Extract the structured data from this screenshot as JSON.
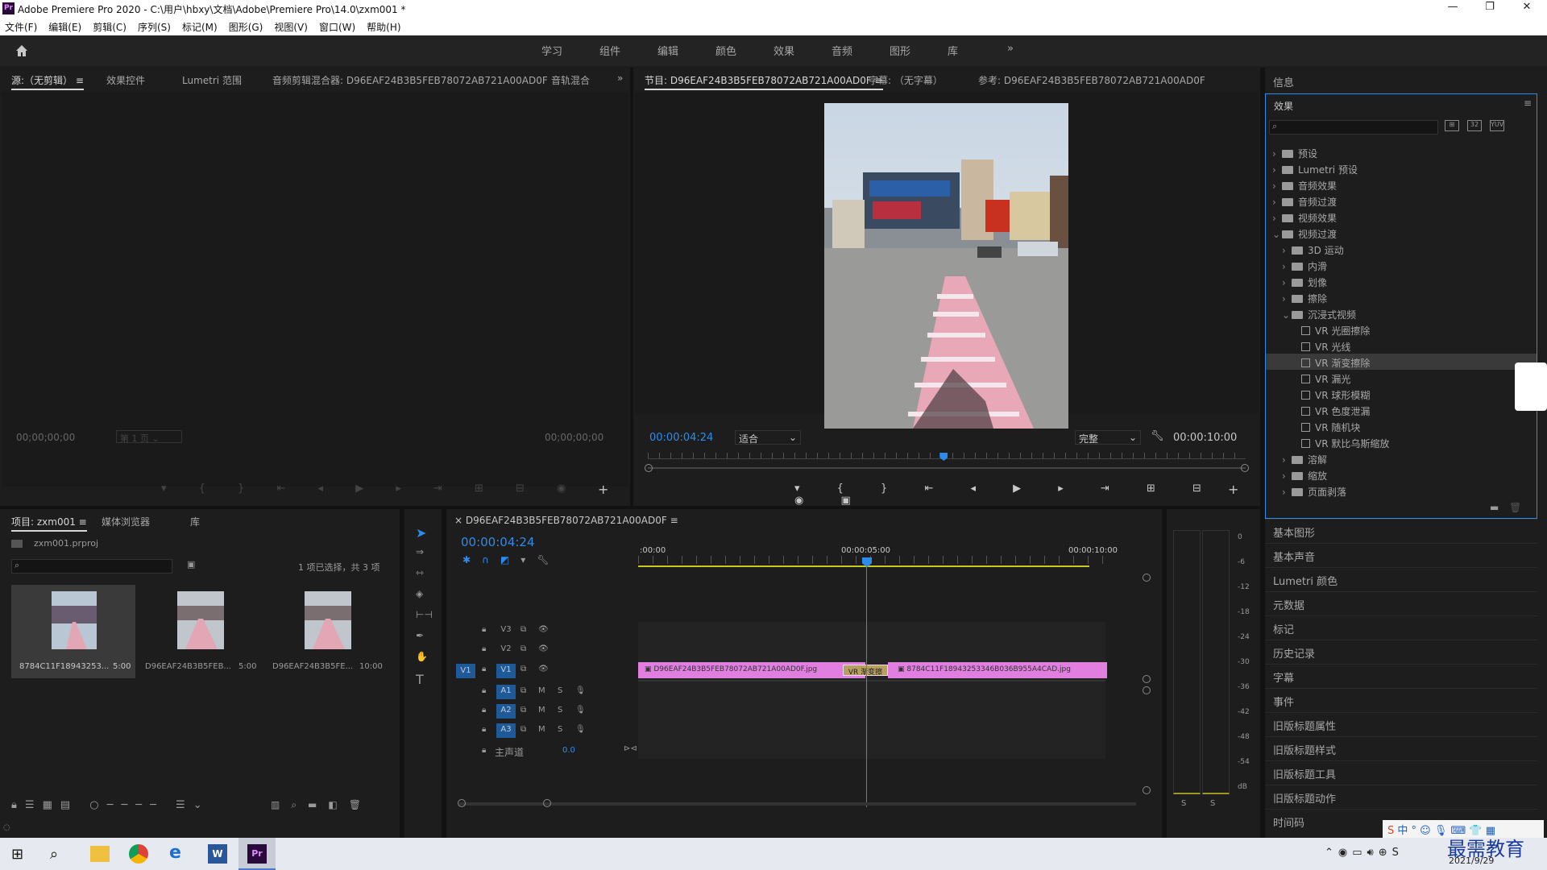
{
  "app": {
    "title": "Adobe Premiere Pro 2020 - C:\\用户\\hbxy\\文档\\Adobe\\Premiere Pro\\14.0\\zxm001 *",
    "icon": "Pr"
  },
  "menu": [
    "文件(F)",
    "编辑(E)",
    "剪辑(C)",
    "序列(S)",
    "标记(M)",
    "图形(G)",
    "视图(V)",
    "窗口(W)",
    "帮助(H)"
  ],
  "workspaces": [
    "学习",
    "组件",
    "编辑",
    "颜色",
    "效果",
    "音频",
    "图形",
    "库"
  ],
  "source_panel": {
    "tabs": [
      "源:（无剪辑）",
      "效果控件",
      "Lumetri 范围",
      "音频剪辑混合器: D96EAF24B3B5FEB78072AB721A00AD0F",
      "音轨混合"
    ],
    "tc_left": "00;00;00;00",
    "tc_right": "00;00;00;00",
    "page_sel": "第 1 页"
  },
  "program_panel": {
    "tabs": [
      "节目: D96EAF24B3B5FEB78072AB721A00AD0F",
      "字幕: （无字幕）",
      "参考: D96EAF24B3B5FEB78072AB721A00AD0F"
    ],
    "timecode": "00:00:04:24",
    "fit": "适合",
    "quality": "完整",
    "duration": "00:00:10:00",
    "playhead_fraction": 0.495
  },
  "info_panel": {
    "title": "信息"
  },
  "effects_panel": {
    "title": "效果",
    "search_placeholder": "",
    "items": [
      {
        "label": "预设",
        "level": 0,
        "kind": "folder",
        "open": false
      },
      {
        "label": "Lumetri 预设",
        "level": 0,
        "kind": "folder",
        "open": false
      },
      {
        "label": "音频效果",
        "level": 0,
        "kind": "folder",
        "open": false
      },
      {
        "label": "音频过渡",
        "level": 0,
        "kind": "folder",
        "open": false
      },
      {
        "label": "视频效果",
        "level": 0,
        "kind": "folder",
        "open": false
      },
      {
        "label": "视频过渡",
        "level": 0,
        "kind": "folder",
        "open": true
      },
      {
        "label": "3D 运动",
        "level": 1,
        "kind": "folder",
        "open": false
      },
      {
        "label": "内滑",
        "level": 1,
        "kind": "folder",
        "open": false
      },
      {
        "label": "划像",
        "level": 1,
        "kind": "folder",
        "open": false
      },
      {
        "label": "擦除",
        "level": 1,
        "kind": "folder",
        "open": false
      },
      {
        "label": "沉浸式视频",
        "level": 1,
        "kind": "folder",
        "open": true
      },
      {
        "label": "VR 光圈擦除",
        "level": 2,
        "kind": "fx"
      },
      {
        "label": "VR 光线",
        "level": 2,
        "kind": "fx"
      },
      {
        "label": "VR 渐变擦除",
        "level": 2,
        "kind": "fx",
        "selected": true
      },
      {
        "label": "VR 漏光",
        "level": 2,
        "kind": "fx"
      },
      {
        "label": "VR 球形模糊",
        "level": 2,
        "kind": "fx"
      },
      {
        "label": "VR 色度泄漏",
        "level": 2,
        "kind": "fx"
      },
      {
        "label": "VR 随机块",
        "level": 2,
        "kind": "fx"
      },
      {
        "label": "VR 默比乌斯缩放",
        "level": 2,
        "kind": "fx"
      },
      {
        "label": "溶解",
        "level": 1,
        "kind": "folder",
        "open": false
      },
      {
        "label": "缩放",
        "level": 1,
        "kind": "folder",
        "open": false
      },
      {
        "label": "页面剥落",
        "level": 1,
        "kind": "folder",
        "open": false
      }
    ]
  },
  "side_panels": [
    "基本图形",
    "基本声音",
    "Lumetri 颜色",
    "元数据",
    "标记",
    "历史记录",
    "字幕",
    "事件",
    "旧版标题属性",
    "旧版标题样式",
    "旧版标题工具",
    "旧版标题动作",
    "时间码"
  ],
  "project_panel": {
    "tabs": [
      "项目: zxm001",
      "媒体浏览器",
      "库"
    ],
    "file": "zxm001.prproj",
    "status": "1 项已选择，共 3 项",
    "items": [
      {
        "name": "8784C11F18943253...",
        "dur": "5:00"
      },
      {
        "name": "D96EAF24B3B5FEB...",
        "dur": "5:00"
      },
      {
        "name": "D96EAF24B3B5FE...",
        "dur": "10:00"
      }
    ]
  },
  "timeline": {
    "tab": "D96EAF24B3B5FEB78072AB721A00AD0F",
    "timecode": "00:00:04:24",
    "ruler": [
      ":00:00",
      "00:00:05:00",
      "00:00:10:00"
    ],
    "tracks": [
      "V3",
      "V2",
      "V1",
      "A1",
      "A2",
      "A3"
    ],
    "master": "主声道",
    "master_val": "0.0",
    "mute": "M",
    "solo": "S",
    "clip1": "D96EAF24B3B5FEB78072AB721A00AD0F.jpg",
    "transition": "VR 渐变擦",
    "clip2": "8784C11F18943253346B036B955A4CAD.jpg"
  },
  "meter": {
    "ticks": [
      "0",
      "-6",
      "-12",
      "-18",
      "-24",
      "-30",
      "-36",
      "-42",
      "-48",
      "-54",
      "dB"
    ],
    "solo": "S"
  },
  "taskbar": {
    "time": "2021/9/29",
    "ime": "中",
    "watermark": "最需教育"
  },
  "colors": {
    "accent": "#2d8ceb",
    "clip": "#e07fe0",
    "transition": "#b8a060",
    "selection": "#3a3a3a"
  }
}
